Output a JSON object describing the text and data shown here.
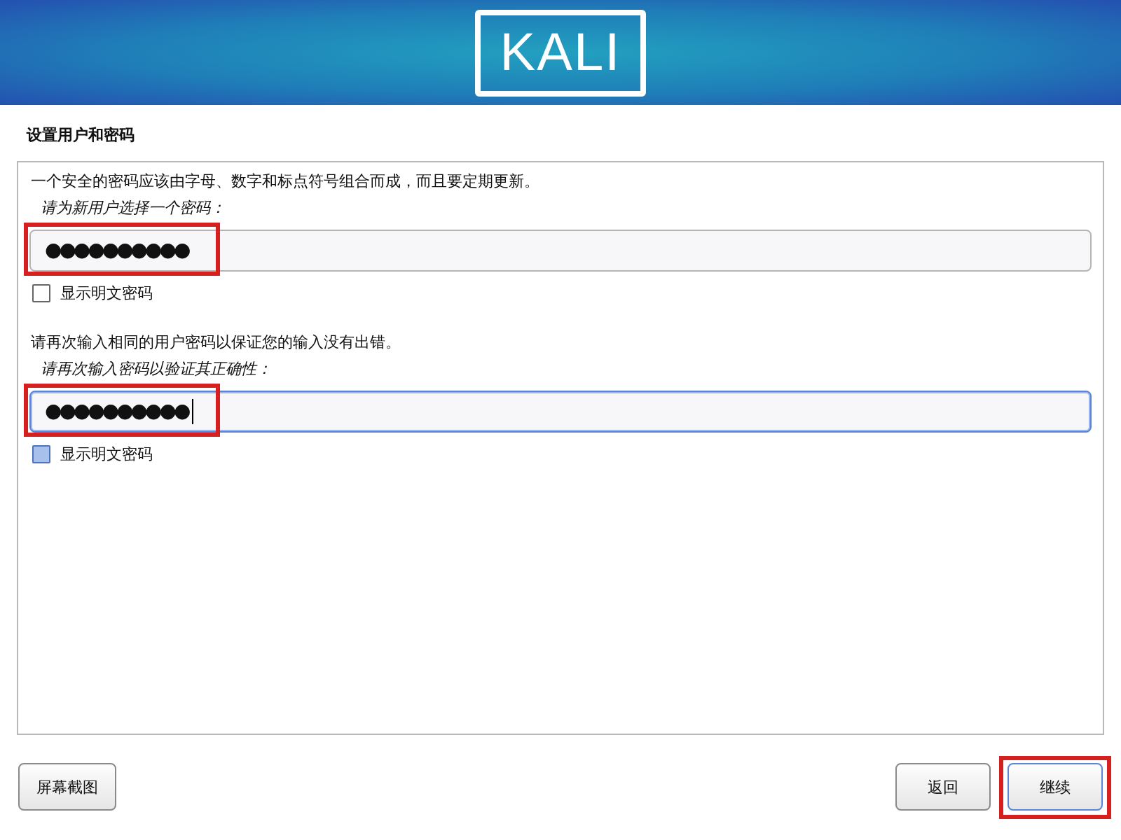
{
  "header": {
    "logo": "KALI"
  },
  "page_title": "设置用户和密码",
  "sections": [
    {
      "hint": "一个安全的密码应该由字母、数字和标点符号组合而成，而且要定期更新。",
      "label": "请为新用户选择一个密码：",
      "field": {
        "value": "●●●●●●●●●●",
        "focused": false,
        "highlighted": true
      },
      "checkbox": {
        "label": "显示明文密码",
        "checked": false,
        "focused": false
      }
    },
    {
      "hint": "请再次输入相同的用户密码以保证您的输入没有出错。",
      "label": "请再次输入密码以验证其正确性：",
      "field": {
        "value": "●●●●●●●●●●",
        "focused": true,
        "highlighted": true
      },
      "checkbox": {
        "label": "显示明文密码",
        "checked": false,
        "focused": true
      }
    }
  ],
  "buttons": [
    {
      "label": "屏幕截图",
      "highlighted": false
    },
    {
      "label": "返回",
      "highlighted": false
    },
    {
      "label": "继续",
      "highlighted": true
    }
  ]
}
